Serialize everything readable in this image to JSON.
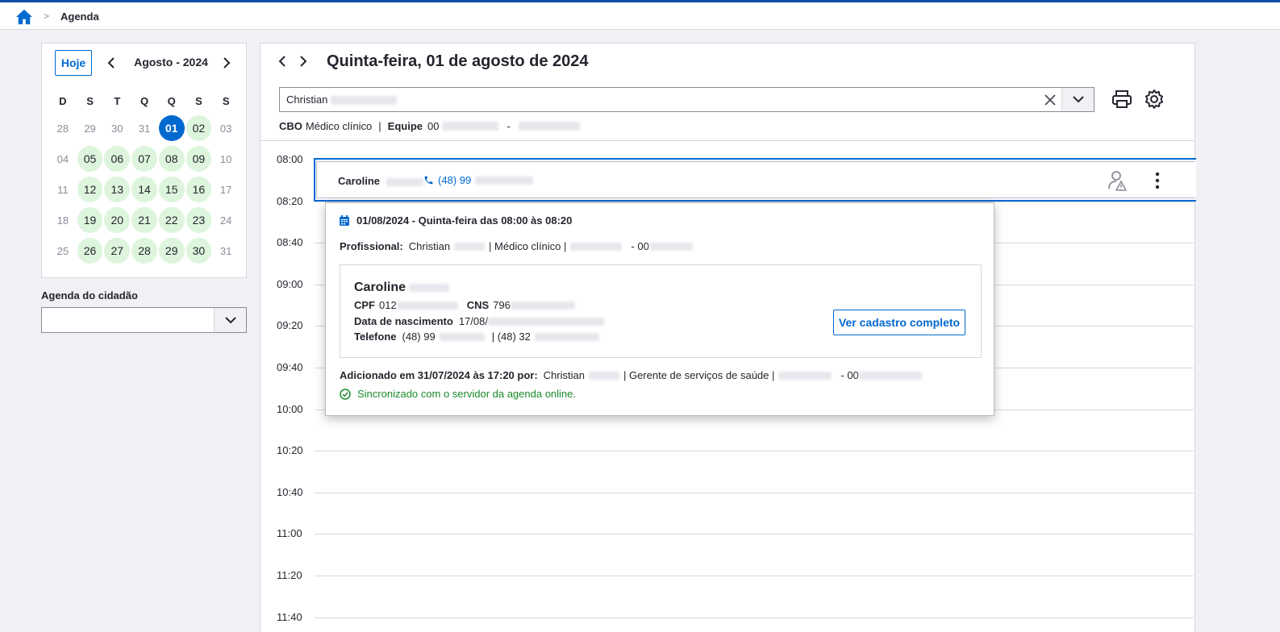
{
  "breadcrumb": {
    "current": "Agenda",
    "separator": ">"
  },
  "calendar": {
    "today_label": "Hoje",
    "month_label": "Agosto - 2024",
    "weekdays": [
      "D",
      "S",
      "T",
      "Q",
      "Q",
      "S",
      "S"
    ],
    "weeks": [
      [
        "28",
        "29",
        "30",
        "31",
        "01",
        "02",
        "03"
      ],
      [
        "04",
        "05",
        "06",
        "07",
        "08",
        "09",
        "10"
      ],
      [
        "11",
        "12",
        "13",
        "14",
        "15",
        "16",
        "17"
      ],
      [
        "18",
        "19",
        "20",
        "21",
        "22",
        "23",
        "24"
      ],
      [
        "25",
        "26",
        "27",
        "28",
        "29",
        "30",
        "31"
      ]
    ],
    "selected": "01"
  },
  "citizen_agenda": {
    "label": "Agenda do cidadão",
    "value": ""
  },
  "main": {
    "day_title": "Quinta-feira, 01 de agosto de 2024",
    "professional_value": "Christian",
    "cbo_label": "CBO",
    "cbo_value": "Médico clínico",
    "cbo_sep": "|",
    "equipe_label": "Equipe",
    "equipe_value": "00",
    "equipe_dash": "-",
    "times": [
      "08:00",
      "08:20",
      "08:40",
      "09:00",
      "09:20",
      "09:40",
      "10:00",
      "10:20",
      "10:40",
      "11:00",
      "11:20",
      "11:40"
    ]
  },
  "appointment": {
    "name": "Caroline",
    "phone": "(48) 99"
  },
  "popover": {
    "header": "01/08/2024 - Quinta-feira das 08:00 às 08:20",
    "prof_label": "Profissional:",
    "prof_name": "Christian",
    "prof_role": "| Médico clínico |",
    "prof_team": "- 00",
    "citizen_name": "Caroline",
    "cpf_label": "CPF",
    "cpf_value": "012",
    "cns_label": "CNS",
    "cns_value": "796",
    "birth_label": "Data de nascimento",
    "birth_value": "17/08/",
    "phone_label": "Telefone",
    "phone_value": "(48) 99",
    "phone2_value": "| (48) 32",
    "ver_button": "Ver cadastro completo",
    "added_label": "Adicionado em 31/07/2024 às 17:20 por:",
    "added_name": "Christian",
    "added_role": "| Gerente de serviços de saúde |",
    "added_team": "- 00",
    "sync_text": "Sincronizado com o servidor da agenda online."
  },
  "colors": {
    "primary": "#0069d0",
    "available": "#ddf5dc",
    "success": "#1b8a2b",
    "topline": "#0d4da1"
  }
}
